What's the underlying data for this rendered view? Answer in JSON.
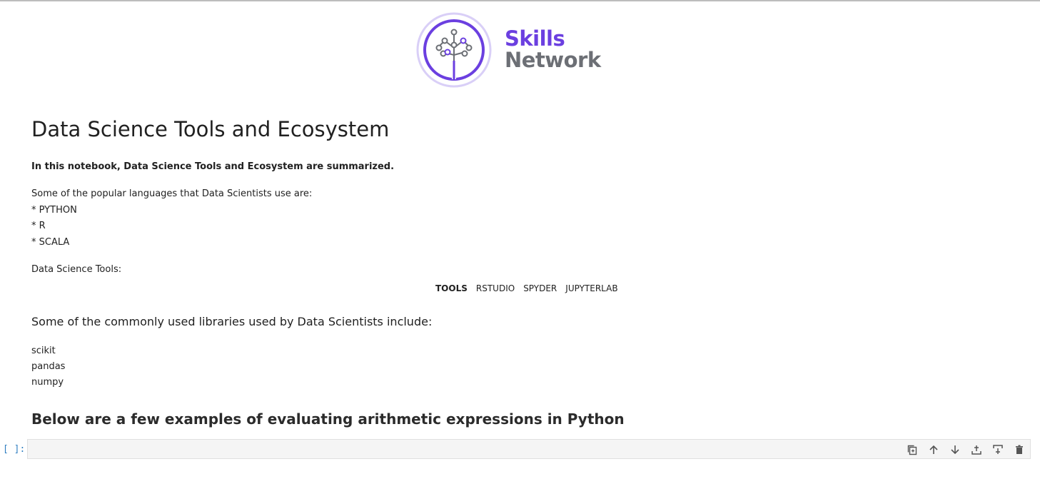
{
  "logo": {
    "line1": "Skills",
    "line2": "Network",
    "colors": {
      "purple": "#6b3fe0",
      "gray": "#6c6f75",
      "ring": "#d9cff7"
    }
  },
  "notebook": {
    "title": "Data Science Tools and Ecosystem",
    "intro": "In this notebook, Data Science Tools and Ecosystem are summarized.",
    "languages_intro": "Some of the popular languages that Data Scientists use are:",
    "languages": [
      "* PYTHON",
      "* R",
      "* SCALA"
    ],
    "tools_label": "Data Science Tools:",
    "tools_table": {
      "header": "TOOLS",
      "items": [
        "RSTUDIO",
        "SPYDER",
        "JUPYTERLAB"
      ]
    },
    "libraries_intro": "Some of the commonly used libraries used by Data Scientists include:",
    "libraries": [
      "scikit",
      "pandas",
      "numpy"
    ],
    "arith_heading": "Below are a few examples of evaluating arithmetic expressions in Python"
  },
  "code_cell": {
    "prompt": "[ ]:",
    "value": "",
    "toolbar": [
      {
        "name": "duplicate-icon"
      },
      {
        "name": "arrow-up-icon"
      },
      {
        "name": "arrow-down-icon"
      },
      {
        "name": "insert-above-icon"
      },
      {
        "name": "insert-below-icon"
      },
      {
        "name": "trash-icon"
      }
    ]
  }
}
